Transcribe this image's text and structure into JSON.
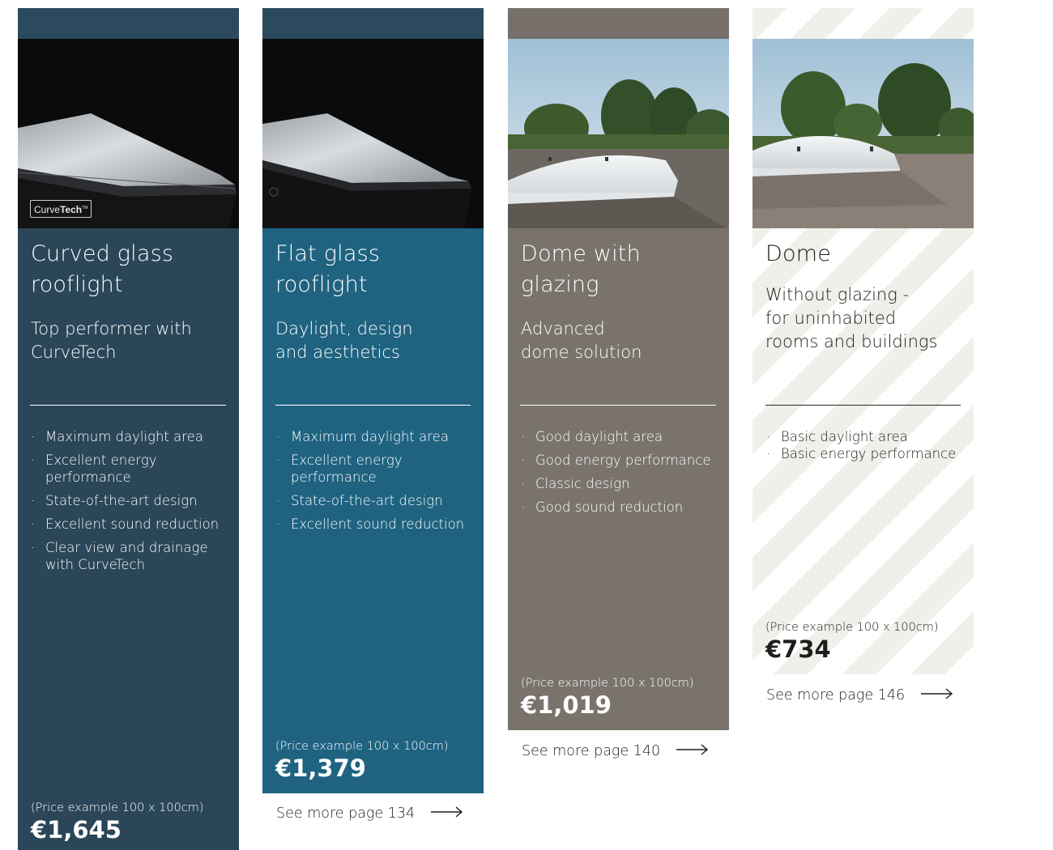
{
  "colors": {
    "card1": "#2a4658",
    "card1_top": "#2c4a5d",
    "card2": "#1f6380",
    "card2_top": "#2c4a5d",
    "card3": "#7a736c",
    "card3_top": "#77706a",
    "card4": "#f1efe9",
    "divider_light": "#ffffff",
    "divider_dark": "#2a2a2a"
  },
  "cards": [
    {
      "title": "Curved glass\nrooflight",
      "subtitle": "Top performer with\nCurveTech",
      "badge_light": "Curve",
      "badge_bold": "Tech",
      "badge_tm": "TM",
      "features": [
        "Maximum daylight area",
        "Excellent energy performance",
        "State-of-the-art design",
        "Excellent sound reduction",
        "Clear view and drainage with CurveTech"
      ],
      "price_note": "(Price example 100 x 100cm)",
      "price": "€1,645"
    },
    {
      "title": "Flat glass\nrooflight",
      "subtitle": "Daylight, design\nand aesthetics",
      "features": [
        "Maximum daylight area",
        "Excellent energy performance",
        "State-of-the-art design",
        "Excellent sound reduction"
      ],
      "price_note": "(Price example 100 x 100cm)",
      "price": "€1,379",
      "see_more": "See more page 134"
    },
    {
      "title": "Dome with\nglazing",
      "subtitle": "Advanced\ndome solution",
      "features": [
        "Good daylight area",
        "Good energy performance",
        "Classic design",
        "Good sound reduction"
      ],
      "price_note": "(Price example 100 x 100cm)",
      "price": "€1,019",
      "see_more": "See more page 140"
    },
    {
      "title": "Dome",
      "subtitle": "Without glazing -\nfor uninhabited\nrooms and buildings",
      "features": [
        "Basic daylight area",
        "Basic energy performance"
      ],
      "price_note": "(Price example 100 x 100cm)",
      "price": "€734",
      "see_more": "See more page 146"
    }
  ]
}
